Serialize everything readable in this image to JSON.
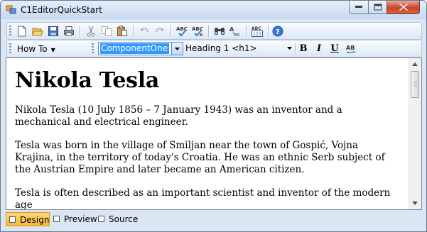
{
  "window": {
    "title": "C1EditorQuickStart"
  },
  "toolbar1": {
    "buttons": [
      "new-document-icon",
      "open-folder-icon",
      "save-icon",
      "print-icon",
      "cut-icon",
      "copy-icon",
      "paste-icon",
      "undo-icon",
      "redo-icon",
      "spell-check-icon",
      "spell-check-dialog-icon",
      "find-icon",
      "replace-icon",
      "insert-table-icon",
      "help-icon"
    ]
  },
  "toolbar2": {
    "how_to_label": "How To",
    "class_combo_value": "ComponentOne",
    "heading_combo_value": "Heading 1 <h1>",
    "bold_label": "B",
    "italic_label": "I",
    "underline_label": "U"
  },
  "document": {
    "heading": "Nikola Tesla",
    "paragraphs": [
      "Nikola Tesla (10 July 1856 – 7 January 1943) was an inventor and a mechanical and electrical engineer.",
      "Tesla was born in the village of Smiljan near the town of Gospić, Vojna Krajina, in the territory of today's Croatia. He was an ethnic Serb subject of the Austrian Empire and later became an American citizen.",
      "Tesla is often described as an important scientist and inventor of the modern age"
    ]
  },
  "tabs": [
    {
      "label": "Design",
      "active": true
    },
    {
      "label": "Preview",
      "active": false
    },
    {
      "label": "Source",
      "active": false
    }
  ]
}
